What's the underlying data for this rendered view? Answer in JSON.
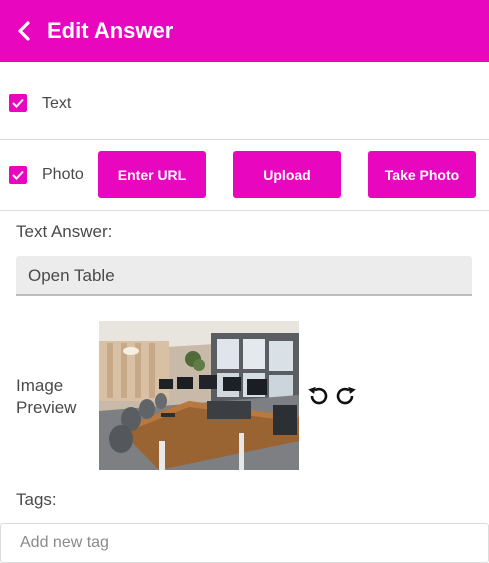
{
  "header": {
    "title": "Edit Answer",
    "back_icon": "chevron-left-icon",
    "background": "#e807be"
  },
  "options": {
    "text": {
      "label": "Text",
      "checked": true
    },
    "photo": {
      "label": "Photo",
      "checked": true
    }
  },
  "photo_buttons": {
    "enter_url": "Enter URL",
    "upload": "Upload",
    "take_photo": "Take Photo"
  },
  "text_answer": {
    "label": "Text Answer:",
    "value": "Open Table"
  },
  "image_preview": {
    "label": "Image Preview",
    "rotate_left_icon": "rotate-left-icon",
    "rotate_right_icon": "rotate-right-icon"
  },
  "tags": {
    "label": "Tags:",
    "placeholder": "Add new tag"
  },
  "colors": {
    "accent": "#e807be",
    "text": "#4a4a4a"
  }
}
